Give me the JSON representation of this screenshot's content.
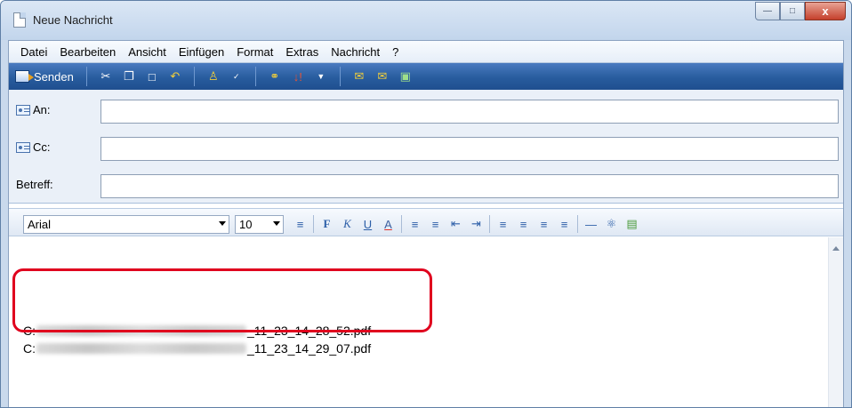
{
  "window": {
    "title": "Neue Nachricht",
    "minimize": "—",
    "maximize": "□",
    "close": "x"
  },
  "menu": [
    "Datei",
    "Bearbeiten",
    "Ansicht",
    "Einfügen",
    "Format",
    "Extras",
    "Nachricht",
    "?"
  ],
  "toolbar": {
    "send_label": "Senden"
  },
  "fields": {
    "to_label": "An:",
    "to_value": "",
    "cc_label": "Cc:",
    "cc_value": "",
    "subject_label": "Betreff:",
    "subject_value": ""
  },
  "format": {
    "font": "Arial",
    "size": "10",
    "bold": "F",
    "italic": "K",
    "underline": "U",
    "color": "A"
  },
  "body": {
    "attachment_1_prefix": "C:",
    "attachment_1_suffix": "_11_23_14_28_52.pdf",
    "attachment_2_prefix": "C:",
    "attachment_2_suffix": "_11_23_14_29_07.pdf"
  },
  "colors": {
    "toolbar": "#285c9e",
    "highlight": "#e0001e",
    "header": "#eaf0f8"
  }
}
